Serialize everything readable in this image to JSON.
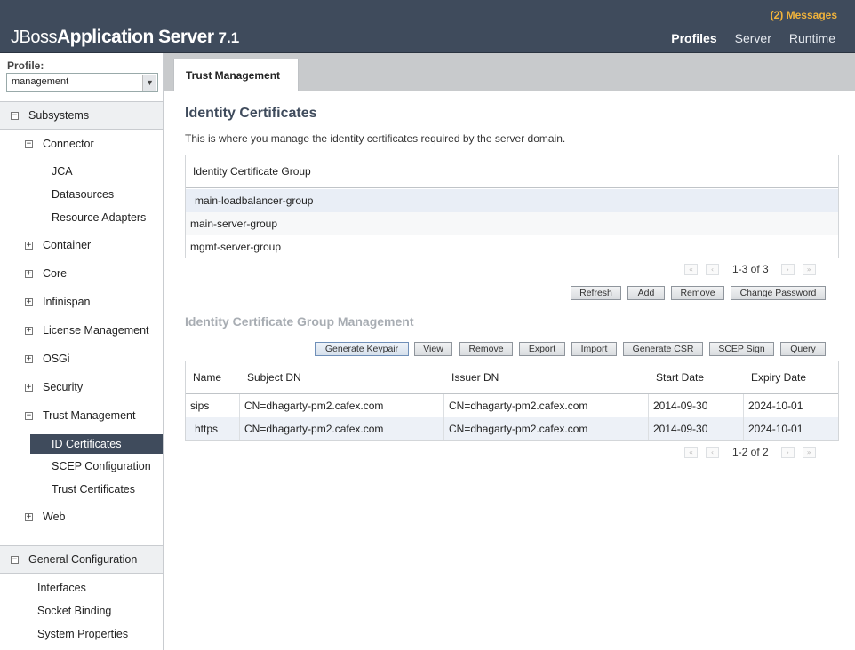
{
  "header": {
    "brand_jboss": "JBoss",
    "brand_app": "Application Server",
    "brand_version": "7.1",
    "messages": "(2) Messages",
    "nav": [
      "Profiles",
      "Server",
      "Runtime"
    ]
  },
  "sidebar": {
    "profile_label": "Profile:",
    "profile_value": "management",
    "subsystems_label": "Subsystems",
    "connector_label": "Connector",
    "connector_items": [
      "JCA",
      "Datasources",
      "Resource Adapters"
    ],
    "groups": [
      "Container",
      "Core",
      "Infinispan",
      "License Management",
      "OSGi",
      "Security"
    ],
    "trust_label": "Trust Management",
    "trust_items": [
      "ID Certificates",
      "SCEP Configuration",
      "Trust Certificates"
    ],
    "web_label": "Web",
    "general_label": "General Configuration",
    "general_items": [
      "Interfaces",
      "Socket Binding",
      "System Properties"
    ]
  },
  "main": {
    "tab": "Trust Management",
    "title": "Identity Certificates",
    "description": "This is where you manage the identity certificates required by the server domain.",
    "group_table": {
      "header": "Identity Certificate Group",
      "rows": [
        "main-loadbalancer-group",
        "main-server-group",
        "mgmt-server-group"
      ],
      "pager": "1-3 of 3"
    },
    "group_buttons": [
      "Refresh",
      "Add",
      "Remove",
      "Change Password"
    ],
    "management_title": "Identity Certificate Group Management",
    "mgmt_buttons": [
      "Generate Keypair",
      "View",
      "Remove",
      "Export",
      "Import",
      "Generate CSR",
      "SCEP Sign",
      "Query"
    ],
    "cert_table": {
      "columns": [
        "Name",
        "Subject DN",
        "Issuer DN",
        "Start Date",
        "Expiry Date"
      ],
      "rows": [
        [
          "sips",
          "CN=dhagarty-pm2.cafex.com",
          "CN=dhagarty-pm2.cafex.com",
          "2014-09-30",
          "2024-10-01"
        ],
        [
          "https",
          "CN=dhagarty-pm2.cafex.com",
          "CN=dhagarty-pm2.cafex.com",
          "2014-09-30",
          "2024-10-01"
        ]
      ],
      "pager": "1-2 of 2"
    }
  }
}
